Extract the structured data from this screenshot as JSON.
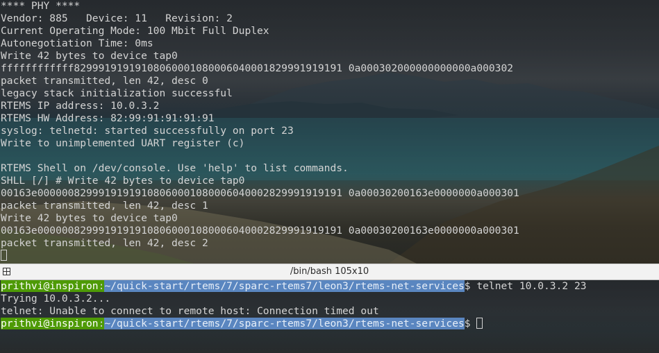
{
  "top_terminal": {
    "lines": [
      "**** PHY ****",
      "Vendor: 885   Device: 11   Revision: 2",
      "Current Operating Mode: 100 Mbit Full Duplex",
      "Autonegotiation Time: 0ms",
      "Write 42 bytes to device tap0",
      "ffffffffffff82999191919108060001080006040001829991919191 0a000302000000000000a000302",
      "packet transmitted, len 42, desc 0",
      "legacy stack initialization successful",
      "RTEMS IP address: 10.0.3.2",
      "RTEMS HW Address: 82:99:91:91:91:91",
      "syslog: telnetd: started successfully on port 23",
      "Write to unimplemented UART register (c)",
      "",
      "RTEMS Shell on /dev/console. Use 'help' to list commands.",
      "SHLL [/] # Write 42 bytes to device tap0",
      "00163e00000082999191919108060001080006040002829991919191 0a00030200163e0000000a000301",
      "packet transmitted, len 42, desc 1",
      "Write 42 bytes to device tap0",
      "00163e00000082999191919108060001080006040002829991919191 0a00030200163e0000000a000301",
      "packet transmitted, len 42, desc 2"
    ]
  },
  "divider": {
    "title": "/bin/bash 105x10"
  },
  "bottom_terminal": {
    "prompt_user": "prithvi@inspiron",
    "prompt_path": "~/quick-start/rtems/7/sparc-rtems7/leon3/rtems-net-services",
    "prompt_symbol": "$",
    "command": " telnet 10.0.3.2 23",
    "output_line_1": "Trying 10.0.3.2...",
    "output_line_2": "telnet: Unable to connect to remote host: Connection timed out"
  },
  "colors": {
    "prompt_user_bg": "#4e9a06",
    "prompt_path_bg": "#5a86c0",
    "terminal_text": "#d4d4d4"
  }
}
